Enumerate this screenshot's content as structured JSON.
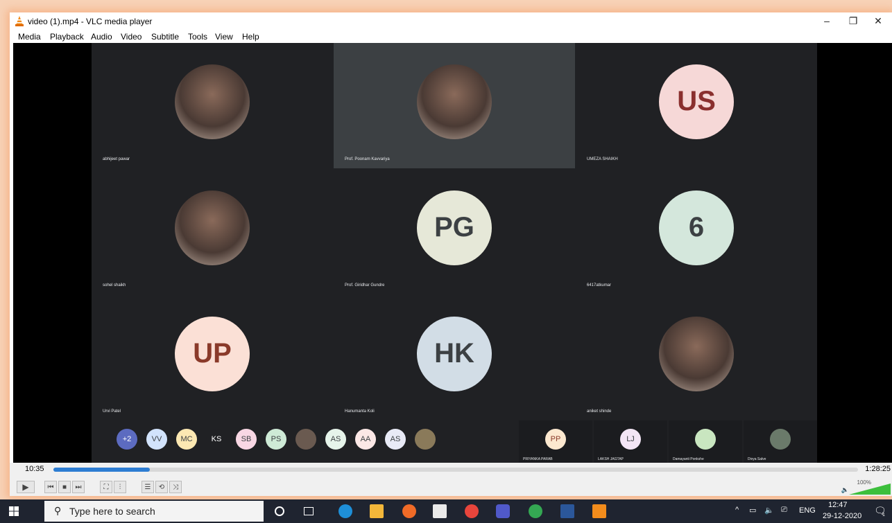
{
  "window": {
    "title": "video (1).mp4 - VLC media player",
    "minimize": "–",
    "restore": "❐",
    "close": "✕"
  },
  "menu": [
    "Media",
    "Playback",
    "Audio",
    "Video",
    "Subtitle",
    "Tools",
    "View",
    "Help"
  ],
  "tiles": [
    {
      "name": "abhijeet pawar",
      "initials": "",
      "photo": true,
      "bg": "#b38a7a",
      "fg": "#fff",
      "active": false
    },
    {
      "name": "Prof. Poonam Kavvariya",
      "initials": "",
      "photo": true,
      "bg": "#5a6a60",
      "fg": "#fff",
      "active": true
    },
    {
      "name": "UMEZA SHAIKH",
      "initials": "US",
      "photo": false,
      "bg": "#f6d8d7",
      "fg": "#8a2f2e",
      "active": false
    },
    {
      "name": "sohel shaikh",
      "initials": "",
      "photo": true,
      "bg": "#7c7c7c",
      "fg": "#fff",
      "active": false
    },
    {
      "name": "Prof. Giridhar Gundre",
      "initials": "PG",
      "photo": false,
      "bg": "#e6e8d8",
      "fg": "#3c4043",
      "active": false
    },
    {
      "name": "6417atkumar",
      "initials": "6",
      "photo": false,
      "bg": "#d4e7dc",
      "fg": "#3c4043",
      "active": false
    },
    {
      "name": "Urvi Patel",
      "initials": "UP",
      "photo": false,
      "bg": "#fbe0d6",
      "fg": "#8a3a2a",
      "active": false
    },
    {
      "name": "Hanumanta Koli",
      "initials": "HK",
      "photo": false,
      "bg": "#d2dde6",
      "fg": "#3c4043",
      "active": false
    },
    {
      "name": "aniket shinde",
      "initials": "",
      "photo": true,
      "bg": "#9a6a40",
      "fg": "#fff",
      "active": false
    }
  ],
  "strip": {
    "minis": [
      {
        "label": "+2",
        "bg": "#5c6bc0",
        "fg": "#fff"
      },
      {
        "label": "VV",
        "bg": "#d2e3fc",
        "fg": "#3c4043"
      },
      {
        "label": "MC",
        "bg": "#fce8b2",
        "fg": "#3c4043"
      },
      {
        "label": "KS",
        "bg": "#202124",
        "fg": "#fff"
      },
      {
        "label": "SB",
        "bg": "#f8d7e4",
        "fg": "#3c4043"
      },
      {
        "label": "PS",
        "bg": "#ceead6",
        "fg": "#3c4043"
      },
      {
        "label": "",
        "bg": "#6a5a50",
        "fg": "#fff"
      },
      {
        "label": "AS",
        "bg": "#e6f4ea",
        "fg": "#3c4043"
      },
      {
        "label": "AA",
        "bg": "#fce8e6",
        "fg": "#3c4043"
      },
      {
        "label": "AS",
        "bg": "#e8eaf6",
        "fg": "#3c4043"
      },
      {
        "label": "",
        "bg": "#8a7a5a",
        "fg": "#fff"
      }
    ],
    "people": [
      {
        "name": "PRIYANKA PARAB",
        "label": "PP",
        "bg": "#fce8cf",
        "fg": "#8a3a2a"
      },
      {
        "name": "LAKSH JAGTAP",
        "label": "LJ",
        "bg": "#f3e5f5",
        "fg": "#3c4043"
      },
      {
        "name": "Damayanti Ponkshe",
        "label": "",
        "bg": "#c9e6c0",
        "fg": "#3c4043"
      },
      {
        "name": "Divya Salve",
        "label": "",
        "bg": "#6a7a6a",
        "fg": "#fff"
      }
    ]
  },
  "player": {
    "current_time": "10:35",
    "total_time": "1:28:25",
    "progress": 0.12,
    "volume_label": "100%",
    "buttons": {
      "play": "▶",
      "prev": "⏮",
      "stop": "■",
      "next": "⏭",
      "fullscreen": "⛶",
      "extended": "⫶",
      "playlist": "☰",
      "loop": "⟲",
      "shuffle": "⤨"
    }
  },
  "taskbar": {
    "search_placeholder": "Type here to search",
    "tray_lang": "ENG",
    "time": "12:47",
    "date": "29-12-2020",
    "notification_count": "1"
  },
  "colors": {
    "accent": "#2d7dd2",
    "meet_bg": "#202124",
    "taskbar": "#1f2430"
  }
}
